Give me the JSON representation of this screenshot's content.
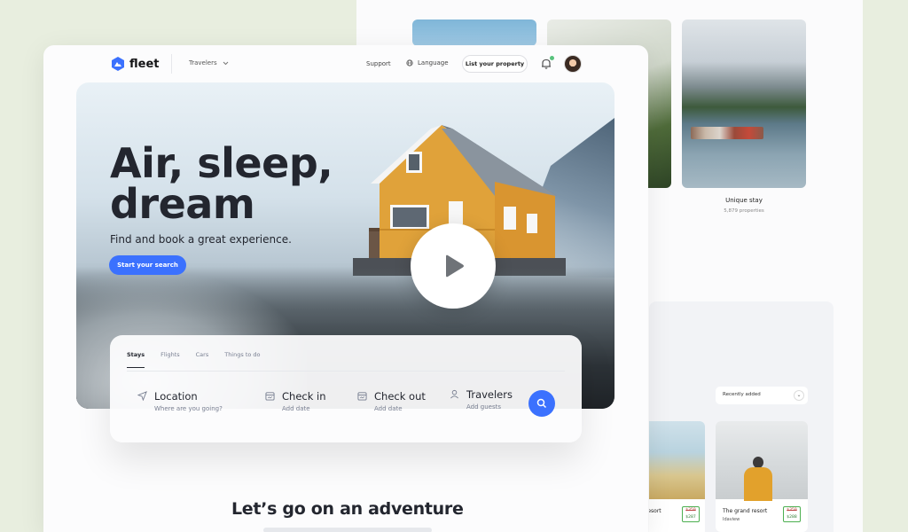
{
  "back_page": {
    "unique_stay_title": "Unique stay",
    "unique_stay_count": "5,879 properties",
    "sort_dropdown": "Recently added",
    "card_left_name": "resort",
    "card_right_name": "The grand resort",
    "card_right_sub": "Idaview",
    "card_left_old_price": "$359",
    "card_left_new_price": "$287",
    "card_right_old_price": "$359",
    "card_right_new_price": "$288"
  },
  "nav": {
    "brand": "fleet",
    "travelers": "Travelers",
    "support": "Support",
    "language": "Language",
    "list_property": "List your property"
  },
  "hero": {
    "title_line1": "Air, sleep,",
    "title_line2": "dream",
    "subtitle": "Find and book a great experience.",
    "cta": "Start your search"
  },
  "search": {
    "tabs": [
      "Stays",
      "Flights",
      "Cars",
      "Things to do"
    ],
    "active_tab": "Stays",
    "location_label": "Location",
    "location_sub": "Where are you going?",
    "checkin_label": "Check in",
    "checkin_sub": "Add date",
    "checkout_label": "Check out",
    "checkout_sub": "Add date",
    "travelers_label": "Travelers",
    "travelers_sub": "Add guests"
  },
  "section": {
    "title": "Let’s go on an adventure"
  },
  "colors": {
    "accent": "#3b71fe",
    "text_dark": "#23262f",
    "text_muted": "#777e90",
    "online_dot": "#58c27d"
  }
}
